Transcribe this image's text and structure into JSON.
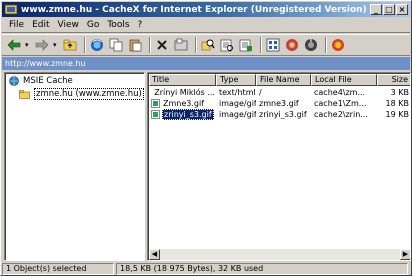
{
  "window": {
    "title": "www.zmne.hu - CacheX for Internet Explorer (Unregistered Version)",
    "controls": {
      "minimize": "_",
      "maximize": "□",
      "close": "×"
    }
  },
  "menu": [
    {
      "label": "File"
    },
    {
      "label": "Edit"
    },
    {
      "label": "View"
    },
    {
      "label": "Go"
    },
    {
      "label": "Tools"
    },
    {
      "label": "?"
    }
  ],
  "toolbar": {
    "icons": [
      "back-arrow-icon",
      "forward-arrow-icon",
      "up-folder-icon",
      "refresh-icon",
      "copy-icon",
      "paste-icon",
      "delete-icon",
      "properties-icon",
      "search-icon",
      "find-icon",
      "filter-icon",
      "view-icon",
      "save-icon",
      "open-icon",
      "help-icon"
    ],
    "colors": {
      "accent": "#0a246a",
      "address_bg": "#6f91c8"
    }
  },
  "address": {
    "url": "http://www.zmne.hu"
  },
  "tree": {
    "root": {
      "label": "MSIE Cache"
    },
    "child": {
      "label": "zmne.hu (www.zmne.hu)"
    }
  },
  "list": {
    "columns": [
      "Title",
      "Type",
      "File Name",
      "Local File",
      "Size"
    ],
    "rows": [
      {
        "title": "Zrínyi Miklós ...",
        "type": "text/html",
        "file": "/",
        "local": "cache4\\zm...",
        "size": "3 KB",
        "icon": "html-page-icon",
        "selected": false
      },
      {
        "title": "Zmne3.gif",
        "type": "image/gif",
        "file": "zmne3.gif",
        "local": "cache1\\Zm...",
        "size": "18 KB",
        "icon": "gif-image-icon",
        "selected": false
      },
      {
        "title": "zrinyi_s3.gif",
        "type": "image/gif",
        "file": "zrinyi_s3.gif",
        "local": "cache2\\zrin...",
        "size": "19 KB",
        "icon": "gif-image-icon",
        "selected": true
      }
    ]
  },
  "status": {
    "selection": "1 Object(s) selected",
    "usage": "18,5 KB (18 975 Bytes), 32 KB used"
  }
}
